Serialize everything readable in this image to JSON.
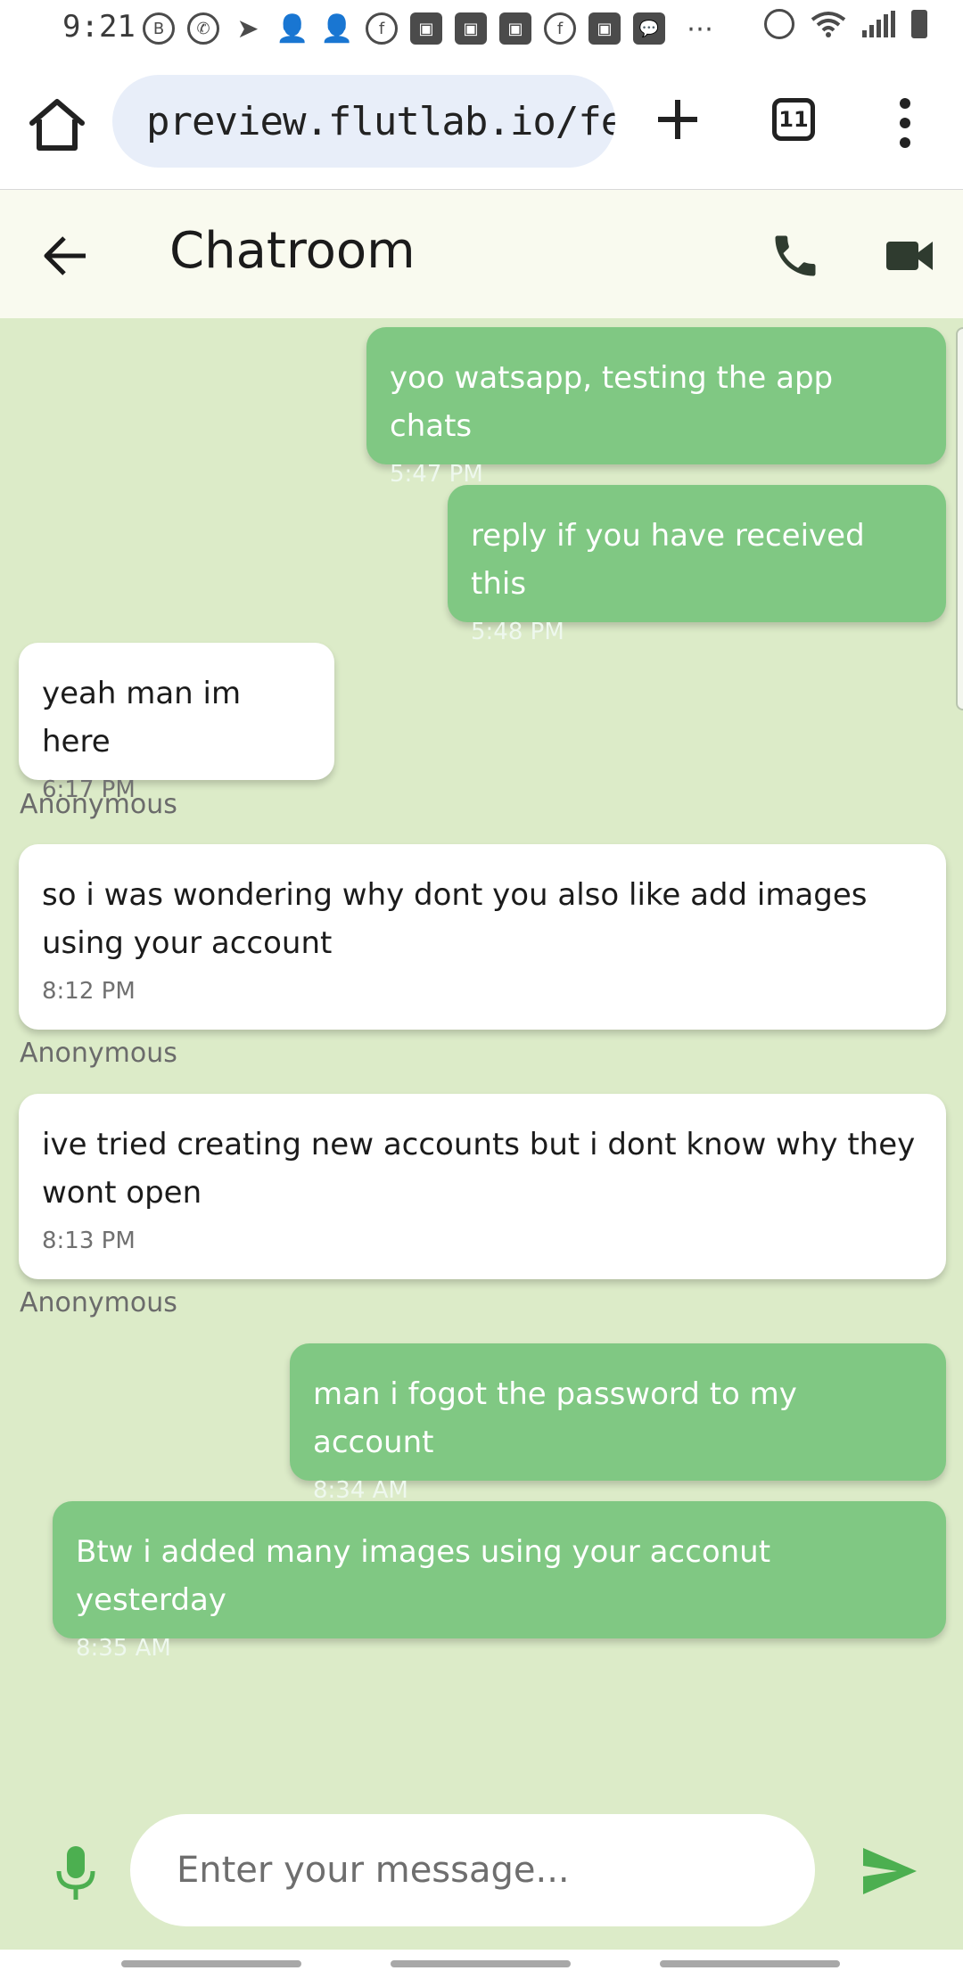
{
  "status_bar": {
    "time": "9:21",
    "notification_icons": [
      "b-icon",
      "whatsapp-icon",
      "telegram-icon",
      "person-add-icon",
      "person-add-icon",
      "facebook-icon",
      "facebook-image-icon",
      "facebook-image-icon",
      "facebook-image-icon",
      "facebook-icon",
      "facebook-image-icon",
      "chat-icon"
    ],
    "overflow": "⋯"
  },
  "browser": {
    "url": "preview.flutlab.io/feni_",
    "tab_count": "11"
  },
  "app": {
    "title": "Chatroom"
  },
  "messages": [
    {
      "from": "me",
      "text": "yoo watsapp, testing the app chats",
      "time": "5:47 PM"
    },
    {
      "from": "me",
      "text": "reply if you have received this",
      "time": "5:48 PM"
    },
    {
      "from": "them",
      "text": "yeah man im here",
      "time": "6:17 PM",
      "sender": "Anonymous"
    },
    {
      "from": "them",
      "text": "so i was wondering why dont you also like add images using your account",
      "time": "8:12 PM",
      "sender": "Anonymous"
    },
    {
      "from": "them",
      "text": "ive tried creating new accounts but i dont know why they wont open",
      "time": "8:13 PM",
      "sender": "Anonymous"
    },
    {
      "from": "me",
      "text": "man i fogot the password to my account",
      "time": "8:34 AM"
    },
    {
      "from": "me",
      "text": "Btw i added many images using your acconut yesterday",
      "time": "8:35 AM"
    }
  ],
  "composer": {
    "placeholder": "Enter your message...",
    "value": ""
  },
  "colors": {
    "chat_background": "#dcebc8",
    "my_bubble": "#80c883",
    "their_bubble": "#ffffff",
    "accent_green": "#4caf50",
    "app_bar": "#f9faef"
  }
}
